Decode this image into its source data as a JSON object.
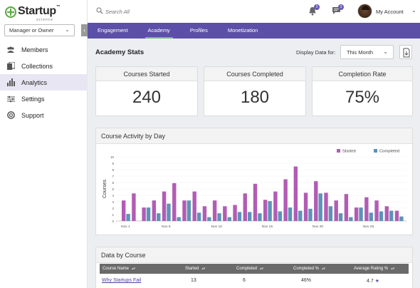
{
  "logo": {
    "name": "Startup",
    "tm": "™",
    "sub": "science"
  },
  "sidebar": {
    "role": "Manager or Owner",
    "items": [
      {
        "label": "Members",
        "icon": "members-icon"
      },
      {
        "label": "Collections",
        "icon": "collections-icon"
      },
      {
        "label": "Analytics",
        "icon": "analytics-icon",
        "active": true
      },
      {
        "label": "Settings",
        "icon": "settings-icon"
      },
      {
        "label": "Support",
        "icon": "support-icon"
      }
    ]
  },
  "header": {
    "search_placeholder": "Search All",
    "notifications_count": "3",
    "messages_count": "3",
    "account_label": "My Account"
  },
  "tabs": [
    "Engagement",
    "Academy",
    "Profiles",
    "Monetization"
  ],
  "active_tab": "Academy",
  "stats": {
    "title": "Academy Stats",
    "display_label": "Display Data for:",
    "period": "This Month",
    "cards": [
      {
        "label": "Courses Started",
        "value": "240"
      },
      {
        "label": "Courses Completed",
        "value": "180"
      },
      {
        "label": "Completion Rate",
        "value": "75%"
      }
    ]
  },
  "activity": {
    "title": "Course Activity by Day"
  },
  "colors": {
    "accent": "#5c4fa8",
    "started": "#b25cb4",
    "completed": "#5e93b6",
    "tab_indicator": "#63c37a"
  },
  "chart_data": {
    "type": "bar",
    "ylabel": "Courses",
    "ylim": [
      0,
      10
    ],
    "yticks": [
      0,
      1,
      2,
      3,
      4,
      5,
      6,
      7,
      8,
      9,
      10
    ],
    "x_tick_labels": [
      "Nov 1",
      "Nov 5",
      "Nov 10",
      "Nov 15",
      "Nov 20",
      "Nov 25"
    ],
    "x_tick_days": [
      1,
      5,
      10,
      15,
      20,
      25
    ],
    "days": [
      1,
      2,
      3,
      4,
      5,
      6,
      7,
      8,
      9,
      10,
      11,
      12,
      13,
      14,
      15,
      16,
      17,
      18,
      19,
      20,
      21,
      22,
      23,
      24,
      25,
      26,
      27,
      28
    ],
    "legend_position": "top-right",
    "series": [
      {
        "name": "Started",
        "values": [
          3.2,
          4.3,
          2.1,
          3.2,
          4.6,
          5.9,
          3.2,
          4.6,
          2.3,
          3.2,
          2.3,
          2.5,
          4.3,
          5.8,
          3.3,
          4.6,
          6.5,
          8.5,
          4.4,
          6.2,
          4.4,
          3.2,
          4.2,
          2.1,
          3.7,
          3.2,
          2.3,
          1.6
        ]
      },
      {
        "name": "Completed",
        "values": [
          1.1,
          0,
          2.1,
          1.2,
          2.7,
          0.6,
          3.2,
          1.3,
          0.6,
          1.2,
          0.6,
          1.4,
          1.4,
          1.2,
          3.1,
          1.5,
          2.1,
          1.6,
          1.9,
          4.3,
          2.3,
          1.2,
          0.6,
          2.1,
          1.3,
          1.5,
          1.6,
          0.7
        ]
      }
    ]
  },
  "table": {
    "title": "Data by Course",
    "columns": [
      "Course Name",
      "Started",
      "Completed",
      "Completed %",
      "Average Rating %"
    ],
    "rows": [
      {
        "name": "Why Startups Fail",
        "started": "13",
        "completed": "6",
        "pct": "46%",
        "rating": "4.7"
      }
    ]
  }
}
